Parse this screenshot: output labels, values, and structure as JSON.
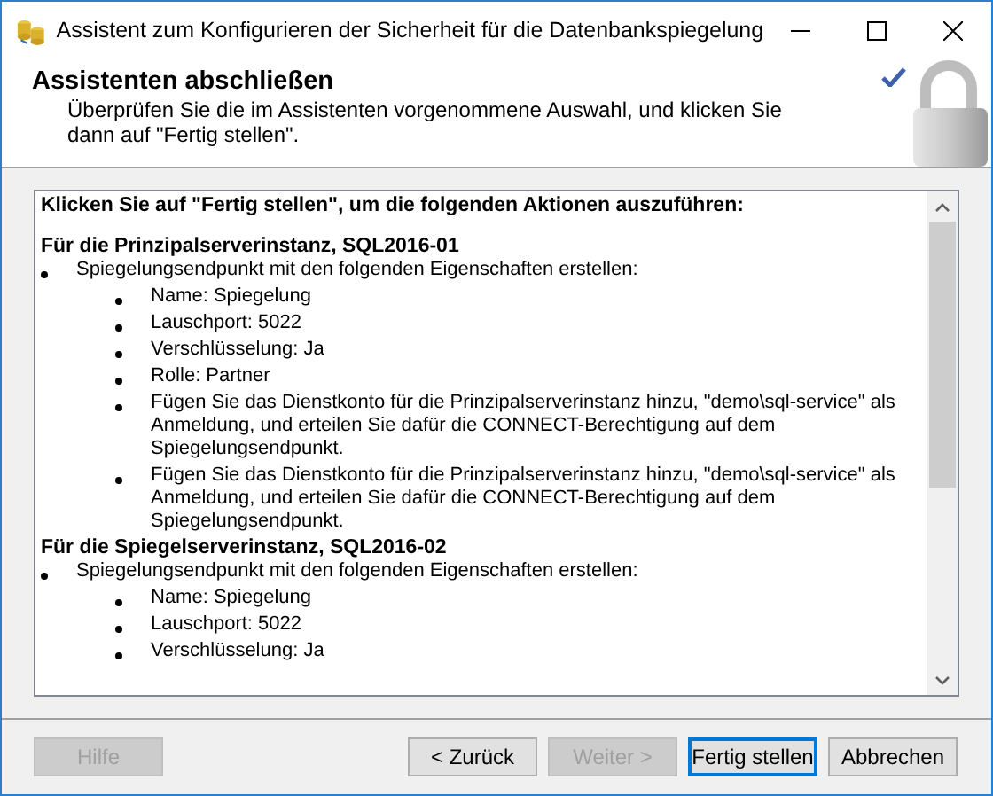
{
  "window": {
    "title": "Assistent zum Konfigurieren der Sicherheit für die Datenbankspiegelung"
  },
  "header": {
    "title": "Assistenten abschließen",
    "subtitle": "Überprüfen Sie die im Assistenten vorgenommene Auswahl, und klicken Sie dann auf \"Fertig stellen\"."
  },
  "summary": {
    "intro": "Klicken Sie auf \"Fertig stellen\", um die folgenden Aktionen auszuführen:",
    "sections": [
      {
        "heading": "Für die Prinzipalserverinstanz, SQL2016-01",
        "items": [
          {
            "text": "Spiegelungsendpunkt mit den folgenden Eigenschaften erstellen:",
            "children": [
              {
                "text": "Name: Spiegelung"
              },
              {
                "text": "Lauschport: 5022"
              },
              {
                "text": "Verschlüsselung: Ja"
              },
              {
                "text": "Rolle: Partner"
              },
              {
                "text": "Fügen Sie das Dienstkonto für die Prinzipalserverinstanz hinzu, \"demo\\sql-service\" als Anmeldung, und erteilen Sie dafür die CONNECT-Berechtigung auf dem Spiegelungsendpunkt."
              },
              {
                "text": "Fügen Sie das Dienstkonto für die Prinzipalserverinstanz hinzu, \"demo\\sql-service\" als Anmeldung, und erteilen Sie dafür die CONNECT-Berechtigung auf dem Spiegelungsendpunkt."
              }
            ]
          }
        ]
      },
      {
        "heading": "Für die Spiegelserverinstanz, SQL2016-02",
        "items": [
          {
            "text": "Spiegelungsendpunkt mit den folgenden Eigenschaften erstellen:",
            "children": [
              {
                "text": "Name: Spiegelung"
              },
              {
                "text": "Lauschport: 5022"
              },
              {
                "text": "Verschlüsselung: Ja"
              }
            ]
          }
        ]
      }
    ]
  },
  "buttons": [
    {
      "label": "Hilfe",
      "disabled": true,
      "default": false
    },
    {
      "label": "< Zurück",
      "disabled": false,
      "default": false
    },
    {
      "label": "Weiter >",
      "disabled": true,
      "default": false
    },
    {
      "label": "Fertig stellen",
      "disabled": false,
      "default": true
    },
    {
      "label": "Abbrechen",
      "disabled": false,
      "default": false
    }
  ]
}
